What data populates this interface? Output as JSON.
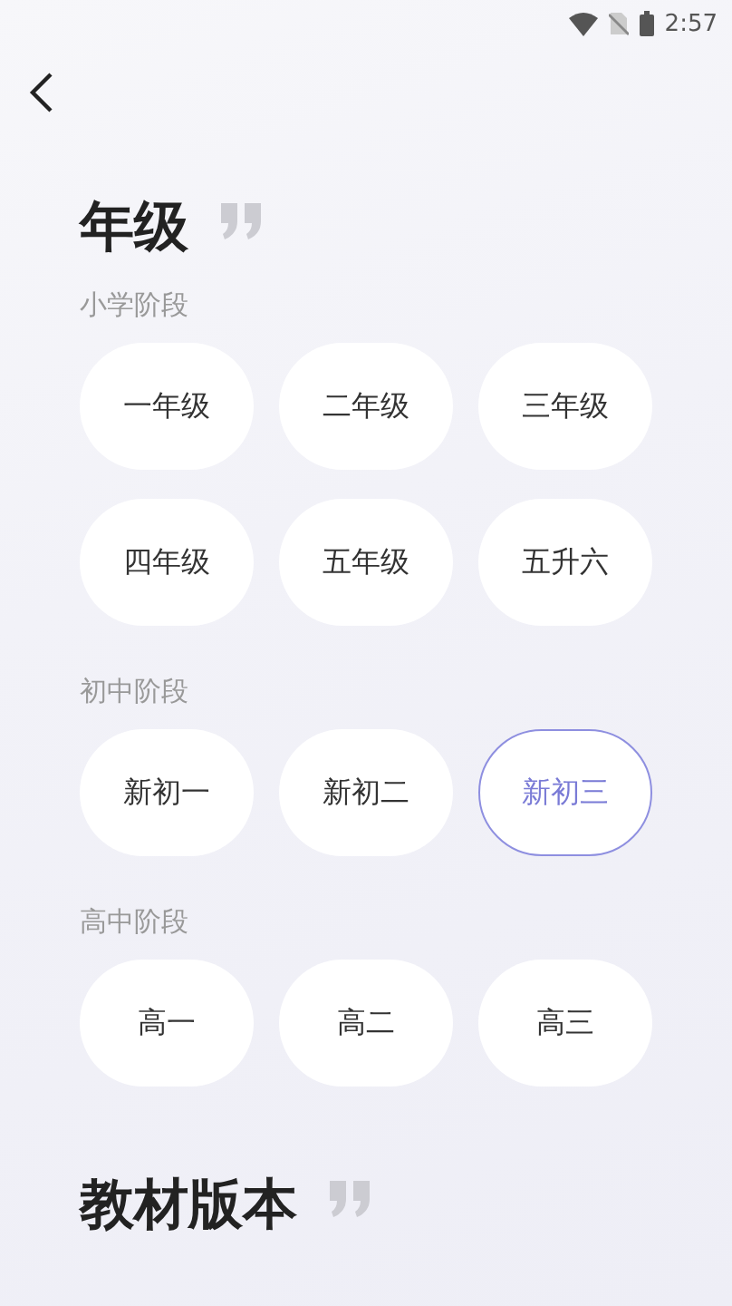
{
  "status_bar": {
    "time": "2:57"
  },
  "title": "年级",
  "sections": [
    {
      "label": "小学阶段",
      "options": [
        {
          "label": "一年级",
          "selected": false
        },
        {
          "label": "二年级",
          "selected": false
        },
        {
          "label": "三年级",
          "selected": false
        },
        {
          "label": "四年级",
          "selected": false
        },
        {
          "label": "五年级",
          "selected": false
        },
        {
          "label": "五升六",
          "selected": false
        }
      ]
    },
    {
      "label": "初中阶段",
      "options": [
        {
          "label": "新初一",
          "selected": false
        },
        {
          "label": "新初二",
          "selected": false
        },
        {
          "label": "新初三",
          "selected": true
        }
      ]
    },
    {
      "label": "高中阶段",
      "options": [
        {
          "label": "高一",
          "selected": false
        },
        {
          "label": "高二",
          "selected": false
        },
        {
          "label": "高三",
          "selected": false
        }
      ]
    }
  ],
  "next_title": "教材版本"
}
